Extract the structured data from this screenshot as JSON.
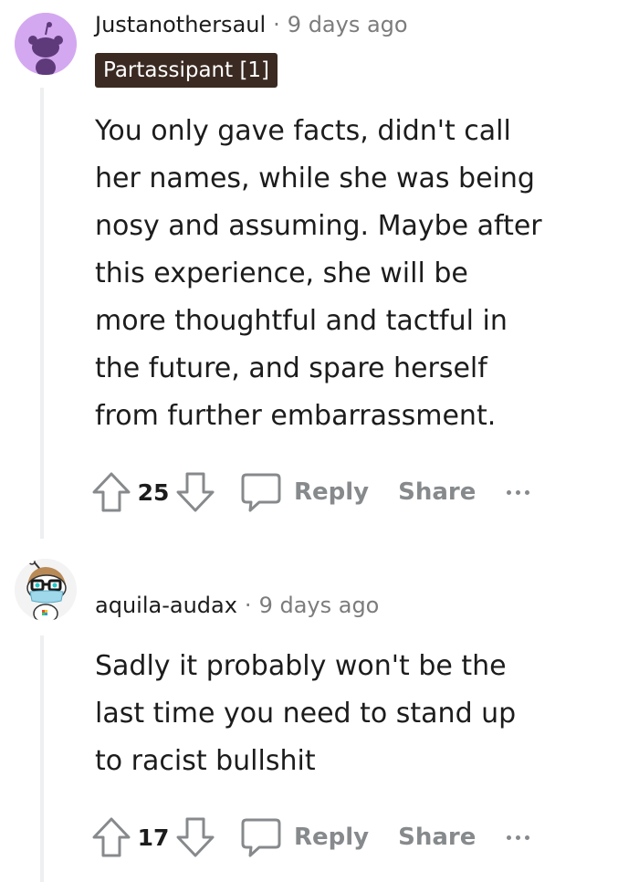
{
  "comments": [
    {
      "username": "Justanothersaul",
      "separator": "·",
      "timestamp": "9 days ago",
      "flair": "Partassipant [1]",
      "avatar_icon": "snoo-avatar-purple-icon",
      "body_lines": [
        "You only gave facts, didn't call",
        "her names, while she was being",
        "nosy and assuming. Maybe after",
        "this experience, she will be",
        "more thoughtful and tactful in",
        "the future, and spare herself",
        "from further embarrassment."
      ],
      "score": "25",
      "reply_label": "Reply",
      "share_label": "Share"
    },
    {
      "username": "aquila-audax",
      "separator": "·",
      "timestamp": "9 days ago",
      "avatar_icon": "snoo-avatar-glasses-mask-icon",
      "body_lines": [
        "Sadly it probably won't be the",
        "last time you need to stand up",
        "to racist bullshit"
      ],
      "score": "17",
      "reply_label": "Reply",
      "share_label": "Share"
    }
  ],
  "colors": {
    "avatar_bg_purple": "#d4a8f0",
    "flair_bg": "#3b2a22",
    "meta_gray": "#7c7c7c",
    "action_gray": "#878a8c",
    "thread_line": "#edeff1"
  }
}
